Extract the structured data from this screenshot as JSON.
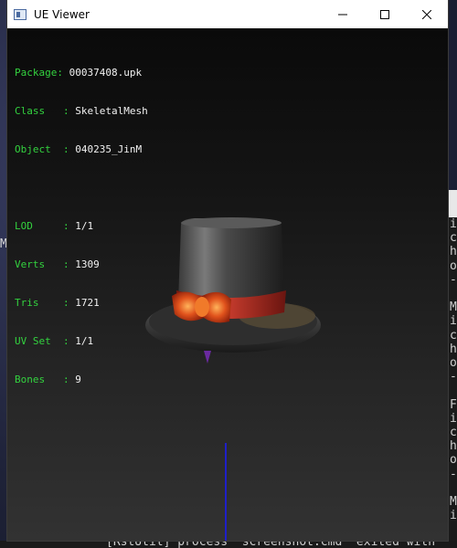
{
  "window": {
    "title": "UE Viewer",
    "controls": {
      "minimize": "minimize",
      "maximize": "maximize",
      "close": "close"
    }
  },
  "info_panel": {
    "package": {
      "label": "Package: ",
      "value": "00037408.upk"
    },
    "class": {
      "label": "Class   : ",
      "value": "SkeletalMesh"
    },
    "object": {
      "label": "Object  : ",
      "value": "040235_JinM"
    },
    "lod": {
      "label": "LOD     : ",
      "value": "1/1"
    },
    "verts": {
      "label": "Verts   : ",
      "value": "1309"
    },
    "tris": {
      "label": "Tris    : ",
      "value": "1721"
    },
    "uvset": {
      "label": "UV Set  : ",
      "value": "1/1"
    },
    "bones": {
      "label": "Bones   : ",
      "value": "9"
    }
  },
  "background": {
    "left_fragment": "M",
    "right_console_lines": [
      "i",
      "c",
      "h",
      "o",
      "-",
      "",
      "M",
      "i",
      "c",
      "h",
      "o",
      "-",
      "",
      "F",
      "i",
      "c",
      "h",
      "o",
      "-",
      "",
      "M",
      "i"
    ],
    "bottom_console_text": "[RstUtil] process \"screenshot.cmd\" exited with"
  },
  "colors": {
    "label_green": "#33d23f",
    "value_white": "#f2f2f2",
    "axis_blue": "#1f1fc8"
  }
}
